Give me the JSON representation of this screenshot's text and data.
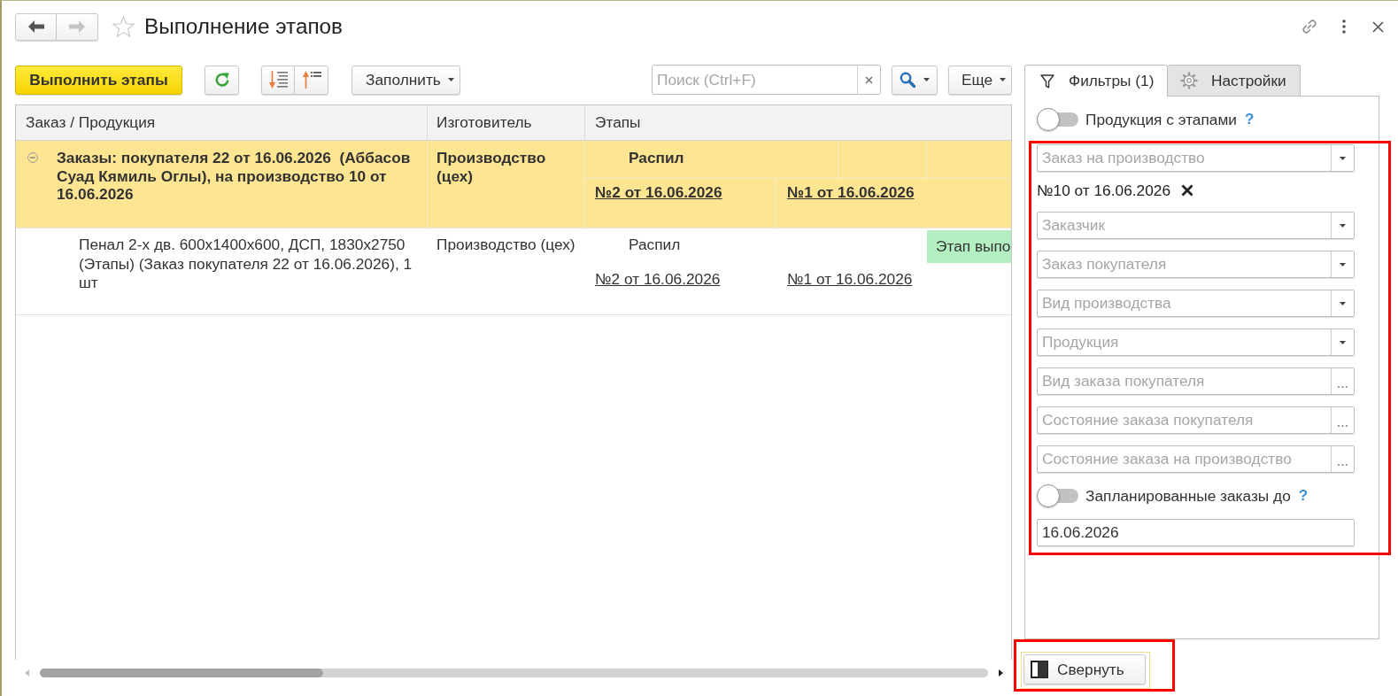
{
  "window": {
    "title": "Выполнение этапов",
    "favorite": false
  },
  "toolbar": {
    "run_button": "Выполнить этапы",
    "fill_button": "Заполнить",
    "search": {
      "placeholder": "Поиск (Ctrl+F)"
    },
    "more_button": "Еще"
  },
  "table": {
    "columns": [
      "Заказ / Продукция",
      "Изготовитель",
      "Этапы"
    ],
    "rows": [
      {
        "kind": "group",
        "expanded": true,
        "product": "Заказы: покупателя 22 от 16.06.2026  (Аббасов Суад Кямиль Оглы), на производство 10 от 16.06.2026",
        "maker": "Производство (цех)",
        "stage": "Распил",
        "documents": [
          "№2 от 16.06.2026",
          "№1 от 16.06.2026"
        ]
      },
      {
        "kind": "item",
        "product": "Пенал 2-х дв. 600х1400х600, ДСП, 1830х2750 (Этапы) (Заказ покупателя 22 от 16.06.2026), 1 шт",
        "maker": "Производство (цех)",
        "stage": "Распил",
        "status": "Этап выпо",
        "documents": [
          "№2 от 16.06.2026",
          "№1 от 16.06.2026"
        ]
      }
    ]
  },
  "filter_panel": {
    "tabs": [
      {
        "label": "Фильтры (1)",
        "selected": true
      },
      {
        "label": "Настройки",
        "selected": false
      }
    ],
    "stages_toggle": {
      "label": "Продукция с этапами",
      "on": false,
      "help": "?"
    },
    "highlighted": true,
    "filters": [
      {
        "kind": "dropdown",
        "placeholder": "Заказ на производство"
      },
      {
        "kind": "chip",
        "value": "№10 от 16.06.2026"
      },
      {
        "kind": "dropdown",
        "placeholder": "Заказчик"
      },
      {
        "kind": "dropdown",
        "placeholder": "Заказ покупателя"
      },
      {
        "kind": "dropdown",
        "placeholder": "Вид производства"
      },
      {
        "kind": "dropdown",
        "placeholder": "Продукция"
      },
      {
        "kind": "choice",
        "placeholder": "Вид заказа покупателя"
      },
      {
        "kind": "choice",
        "placeholder": "Состояние заказа покупателя"
      },
      {
        "kind": "choice",
        "placeholder": "Состояние заказа на производство"
      },
      {
        "kind": "toggle",
        "label": "Запланированные заказы до",
        "on": false,
        "help": "?"
      },
      {
        "kind": "date",
        "value": "16.06.2026"
      }
    ]
  },
  "collapse_button": {
    "label": "Свернуть",
    "highlighted": true
  }
}
